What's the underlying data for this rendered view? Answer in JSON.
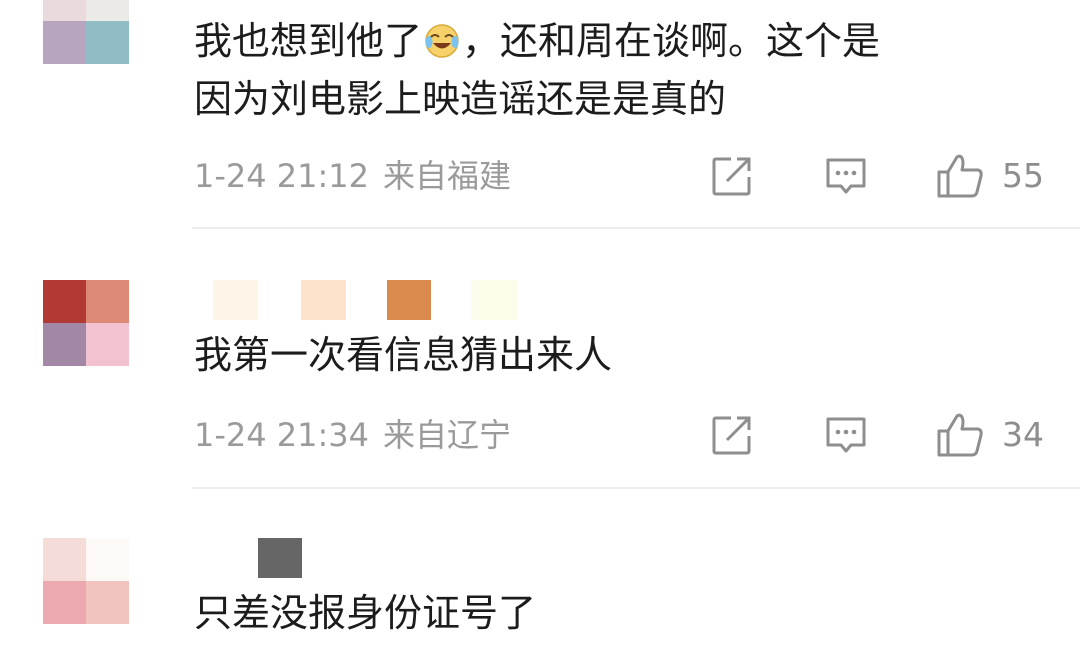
{
  "comments": [
    {
      "text_before": "我也想到他了",
      "emoji": "face-with-tears-of-joy-icon",
      "text_after": "，还和周在谈啊。这个是\n因为刘电影上映造谣还是是真的",
      "time": "1-24 21:12",
      "region": "来自福建",
      "likes": "55",
      "avatar_colors": [
        "#ead9dd",
        "#eceae7",
        "#b7a4bf",
        "#91bcc6"
      ],
      "name_colors": []
    },
    {
      "text": "我第一次看信息猜出来人",
      "time": "1-24 21:34",
      "region": "来自辽宁",
      "likes": "34",
      "avatar_colors": [
        "#b13a35",
        "#dc8a77",
        "#a288a6",
        "#f3c2d0"
      ],
      "name_colors": [
        "#fdf6e8",
        "#fde2cc",
        "#d98a4c",
        "#fdfbe9"
      ]
    },
    {
      "text": "只差没报身份证号了",
      "avatar_colors": [
        "#f6dcd8",
        "#fdf9f7",
        "#ecaab0",
        "#f3c3c0"
      ],
      "name_colors": [
        "#666666"
      ]
    }
  ]
}
